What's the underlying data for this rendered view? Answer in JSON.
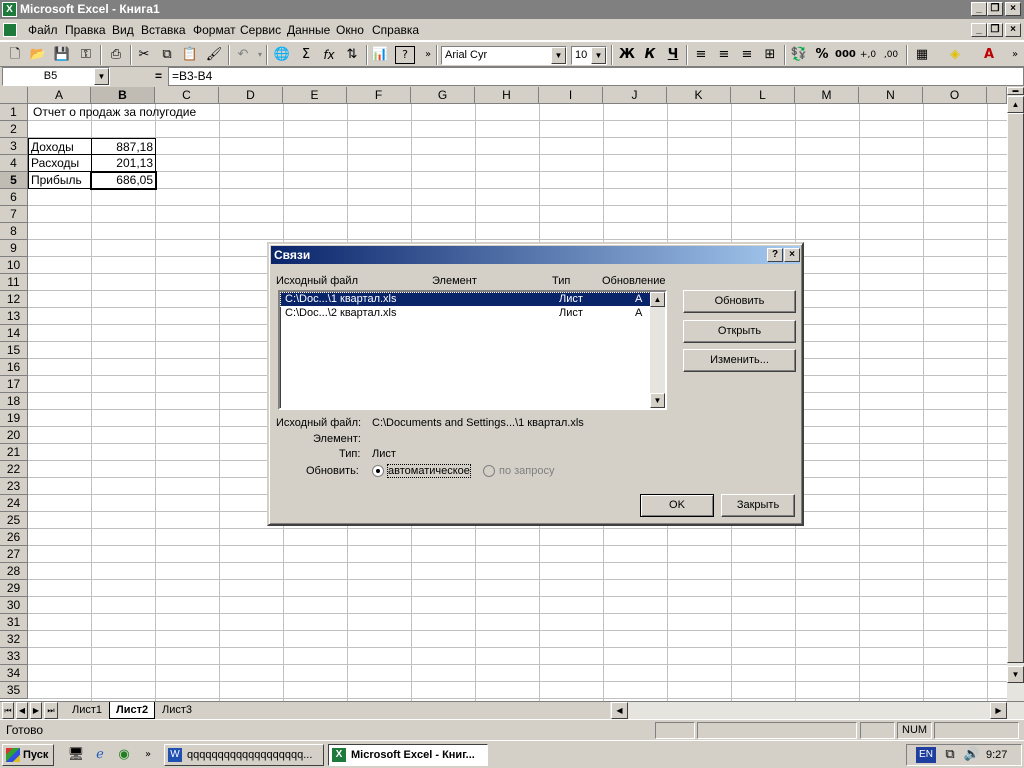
{
  "window": {
    "title": "Microsoft Excel - Книга1",
    "app_icon": "X"
  },
  "menu": [
    "Файл",
    "Правка",
    "Вид",
    "Вставка",
    "Формат",
    "Сервис",
    "Данные",
    "Окно",
    "Справка"
  ],
  "toolbar": {
    "font": "Arial Cyr",
    "size": "10",
    "bold": "Ж",
    "italic": "К",
    "underline": "Ч",
    "percent": "%",
    "thousands": "000",
    "sum": "Σ",
    "fx": "fx"
  },
  "formula": {
    "name_box": "B5",
    "eq": "=",
    "content": "=B3-B4"
  },
  "columns": [
    "A",
    "B",
    "C",
    "D",
    "E",
    "F",
    "G",
    "H",
    "I",
    "J",
    "K",
    "L",
    "M",
    "N",
    "O"
  ],
  "rows": [
    "1",
    "2",
    "3",
    "4",
    "5",
    "6",
    "7",
    "8",
    "9",
    "10",
    "11",
    "12",
    "13",
    "14",
    "15",
    "16",
    "17",
    "18",
    "19",
    "20",
    "21",
    "22",
    "23",
    "24",
    "25",
    "26",
    "27",
    "28",
    "29",
    "30",
    "31",
    "32",
    "33",
    "34",
    "35"
  ],
  "cells": {
    "a1": "Отчет о продаж за полугодие",
    "a3": "Доходы",
    "b3": "887,18",
    "a4": "Расходы",
    "b4": "201,13",
    "a5": "Прибыль",
    "b5": "686,05"
  },
  "sheets": [
    "Лист1",
    "Лист2",
    "Лист3"
  ],
  "status": {
    "ready": "Готово",
    "num": "NUM"
  },
  "taskbar": {
    "start": "Пуск",
    "task1": "qqqqqqqqqqqqqqqqqqq...",
    "task2": "Microsoft Excel - Книг...",
    "lang": "EN",
    "time": "9:27"
  },
  "dialog": {
    "title": "Связи",
    "help": "?",
    "close": "×",
    "headers": {
      "source": "Исходный файл",
      "element": "Элемент",
      "type": "Тип",
      "update": "Обновление"
    },
    "links": [
      {
        "source": "C:\\Doc...\\1 квартал.xls",
        "type": "Лист",
        "update": "A"
      },
      {
        "source": "C:\\Doc...\\2 квартал.xls",
        "type": "Лист",
        "update": "A"
      }
    ],
    "buttons": {
      "refresh": "Обновить",
      "open": "Открыть",
      "change": "Изменить...",
      "ok": "OK",
      "close_btn": "Закрыть"
    },
    "details": {
      "source_label": "Исходный файл:",
      "source_value": "C:\\Documents and Settings...\\1 квартал.xls",
      "element_label": "Элемент:",
      "type_label": "Тип:",
      "type_value": "Лист",
      "update_label": "Обновить:",
      "auto": "автоматическое",
      "manual": "по запросу"
    }
  }
}
